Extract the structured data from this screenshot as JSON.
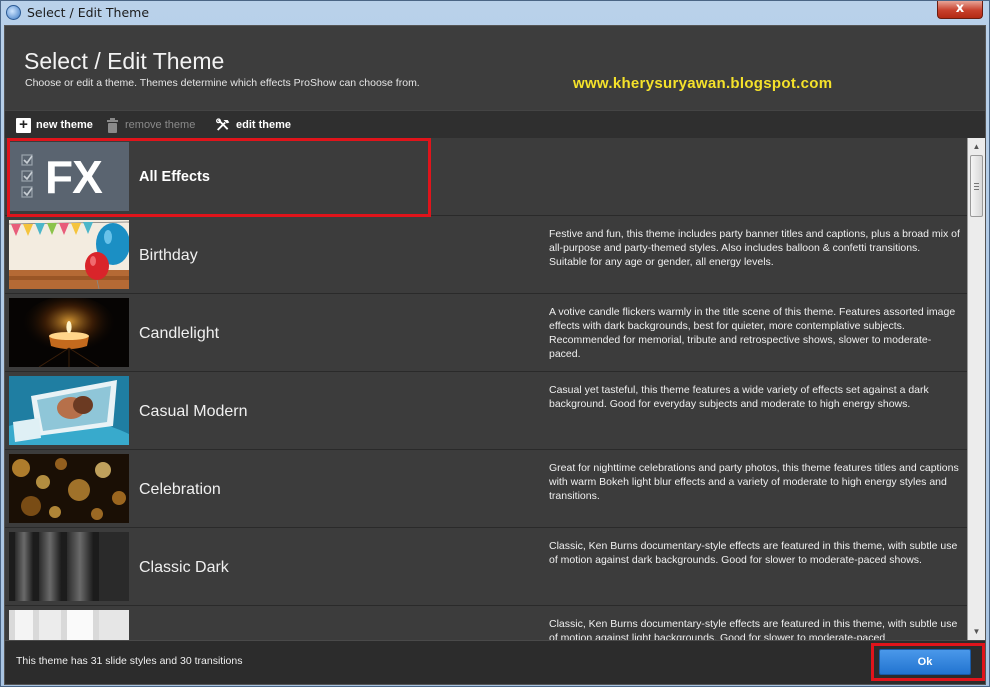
{
  "window": {
    "title": "Select / Edit Theme",
    "close_label": "x"
  },
  "header": {
    "title": "Select / Edit Theme",
    "subtitle": "Choose or edit a theme. Themes determine which effects ProShow can choose from.",
    "watermark": "www.kherysuryawan.blogspot.com"
  },
  "toolbar": {
    "new_theme": "new theme",
    "remove_theme": "remove theme",
    "edit_theme": "edit theme"
  },
  "themes": [
    {
      "name": "All Effects",
      "description": "",
      "thumb_icon": "fx-icon",
      "fx_text": "FX"
    },
    {
      "name": "Birthday",
      "description": "Festive and fun, this theme includes party banner titles and captions, plus a broad mix of all-purpose and party-themed styles. Also includes balloon & confetti transitions. Suitable for any age or gender, all energy levels."
    },
    {
      "name": "Candlelight",
      "description": "A votive candle flickers warmly in the title scene of this theme. Features assorted image effects with dark backgrounds, best for quieter, more contemplative subjects. Recommended for memorial, tribute and retrospective shows, slower to moderate-paced."
    },
    {
      "name": "Casual Modern",
      "description": "Casual yet tasteful, this theme features a wide variety of effects set against a dark background. Good for everyday subjects and moderate to high energy shows."
    },
    {
      "name": "Celebration",
      "description": "Great for nighttime celebrations and party photos, this theme features titles and captions with warm Bokeh light blur effects and a variety of moderate to high energy styles and transitions."
    },
    {
      "name": "Classic Dark",
      "description": "Classic, Ken Burns documentary-style effects are featured in this theme, with subtle use of motion against dark backgrounds. Good for slower to moderate-paced shows."
    },
    {
      "name": "",
      "description": "Classic, Ken Burns documentary-style effects are featured in this theme, with subtle use of motion against light backgrounds. Good for slower to moderate-paced"
    }
  ],
  "footer": {
    "status": "This theme has 31 slide styles and 30 transitions",
    "ok_label": "Ok"
  },
  "colors": {
    "highlight": "#e0141b",
    "watermark": "#f5e22a",
    "ok_button": "#2f85dd"
  }
}
